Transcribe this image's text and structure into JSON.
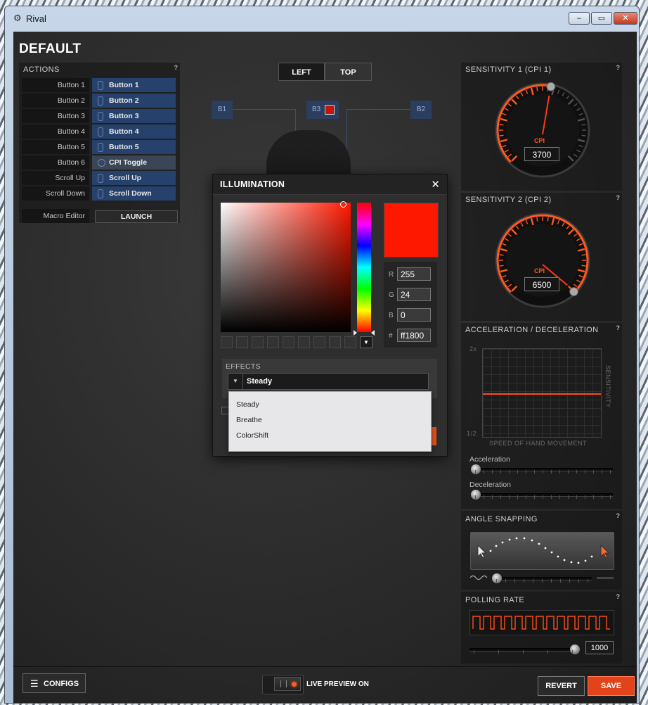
{
  "window": {
    "title": "Rival",
    "app_icon": "steelseries-logo-icon",
    "min": "–",
    "max": "▭",
    "close": "✕"
  },
  "profile_name": "DEFAULT",
  "help_mark": "?",
  "actions": {
    "title": "ACTIONS",
    "rows": [
      {
        "button": "Button 1",
        "assigned": "Button 1"
      },
      {
        "button": "Button 2",
        "assigned": "Button 2"
      },
      {
        "button": "Button 3",
        "assigned": "Button 3"
      },
      {
        "button": "Button 4",
        "assigned": "Button 4"
      },
      {
        "button": "Button 5",
        "assigned": "Button 5"
      },
      {
        "button": "Button 6",
        "assigned": "CPI Toggle"
      },
      {
        "button": "Scroll Up",
        "assigned": "Scroll Up"
      },
      {
        "button": "Scroll Down",
        "assigned": "Scroll Down"
      }
    ],
    "macro_label": "Macro Editor",
    "macro_button": "LAUNCH"
  },
  "view_toggle": {
    "left": "LEFT",
    "top": "TOP"
  },
  "button_markers": {
    "b1": "B1",
    "b3": "B3",
    "b2": "B2"
  },
  "illumination": {
    "title": "ILLUMINATION",
    "close_glyph": "✕",
    "current_color": "#ff1800",
    "r_label": "R",
    "g_label": "G",
    "b_label": "B",
    "hex_label": "#",
    "r": "255",
    "g": "24",
    "b": "0",
    "hex": "ff1800",
    "effects_title": "EFFECTS",
    "effect_selected": "Steady",
    "effect_options": [
      "Steady",
      "Breathe",
      "ColorShift"
    ]
  },
  "sensitivity1": {
    "title": "SENSITIVITY 1 (CPI 1)",
    "cpi_label": "CPI",
    "value": "3700",
    "level": 0.54
  },
  "sensitivity2": {
    "title": "SENSITIVITY 2 (CPI 2)",
    "cpi_label": "CPI",
    "value": "6500",
    "level": 1.0
  },
  "accel": {
    "title": "ACCELERATION / DECELERATION",
    "y_top": "2x",
    "y_bottom": "1/2",
    "x_axis": "SPEED OF HAND MOVEMENT",
    "y_axis": "SENSITIVITY",
    "accel_label": "Acceleration",
    "decel_label": "Deceleration",
    "accel_level": 0.0,
    "decel_level": 0.0
  },
  "angle_snapping": {
    "title": "ANGLE SNAPPING",
    "level": 0.2
  },
  "polling": {
    "title": "POLLING RATE",
    "value": "1000",
    "level": 1.0
  },
  "bottom": {
    "configs": "CONFIGS",
    "live_preview": "LIVE PREVIEW ON",
    "revert": "REVERT",
    "save": "SAVE"
  },
  "colors": {
    "accent": "#ff4d14",
    "button_blue": "#26416c"
  }
}
